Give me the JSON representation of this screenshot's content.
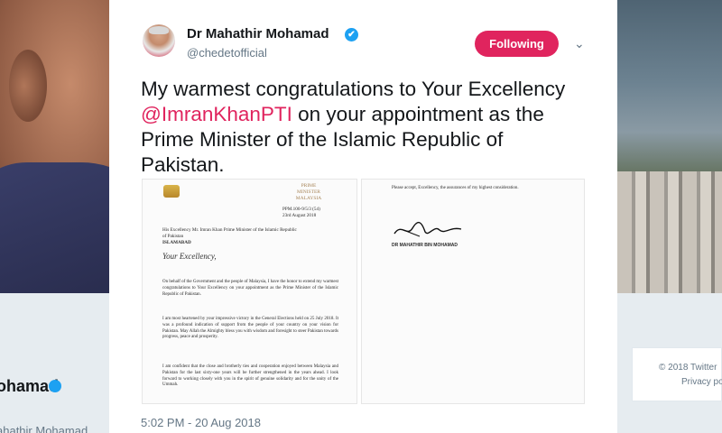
{
  "background": {
    "profile_name": "ohamad",
    "profile_handle": "ahathir Mohamad",
    "footer_copyright": "© 2018 Twitter",
    "footer_privacy": "Privacy po"
  },
  "tweet": {
    "author": {
      "display_name": "Dr Mahathir Mohamad",
      "handle": "@chedetofficial",
      "verified_icon": "✔"
    },
    "follow_button": "Following",
    "menu_icon": "⌄",
    "text": {
      "part1": "My warmest congratulations to Your Excellency ",
      "mention": "@ImranKhanPTI",
      "part2": " on your appointment as the Prime Minister of the Islamic Republic of Pakistan."
    },
    "timestamp": "5:02 PM - 20 Aug 2018",
    "letter": {
      "office": "PRIME MINISTER MALAYSIA",
      "reference": "PPM.100-9/5/3 (54)",
      "date": "23rd August 2018",
      "address": "His Excellency Mr. Imran Khan Prime Minister of the Islamic Republic of Pakistan",
      "city": "ISLAMABAD",
      "salutation": "Your Excellency,",
      "paragraph1": "On behalf of the Government and the people of Malaysia, I have the honor to extend my warmest congratulations to Your Excellency on your appointment as the Prime Minister of the Islamic Republic of Pakistan.",
      "paragraph2": "I am most heartened by your impressive victory in the General Elections held on 25 July 2018. It was a profound indication of support from the people of your country on your vision for Pakistan. May Allah the Almighty bless you with wisdom and foresight to steer Pakistan towards progress, peace and prosperity.",
      "paragraph3": "I am confident that the close and brotherly ties and cooperation enjoyed between Malaysia and Pakistan for the last sixty-one years will be further strengthened in the years ahead. I look forward to working closely with you in the spirit of genuine solidarity and for the unity of the Ummah.",
      "closing": "Please accept, Excellency, the assurances of my highest consideration.",
      "signatory": "DR MAHATHIR BIN MOHAMAD"
    }
  },
  "colors": {
    "accent": "#e0245e",
    "verified": "#1da1f2",
    "text_secondary": "#657786"
  }
}
